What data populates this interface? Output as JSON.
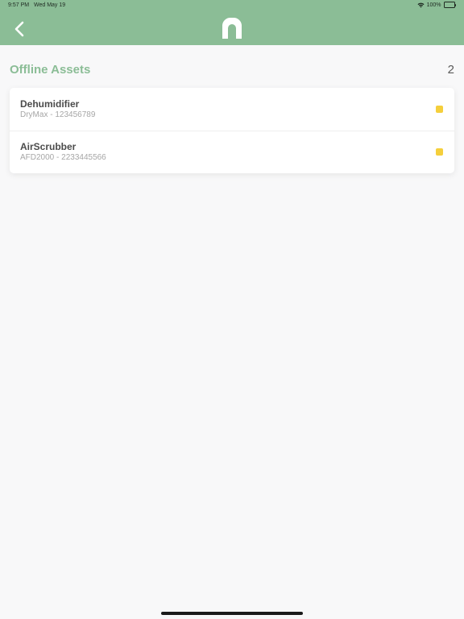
{
  "status_bar": {
    "time": "9:57 PM",
    "date": "Wed May 19",
    "battery": "100%"
  },
  "header": {
    "back_icon": "chevron-left-icon",
    "logo_icon": "arch-logo-icon",
    "color": "#8bbd96"
  },
  "section": {
    "title": "Offline Assets",
    "count": "2"
  },
  "assets": [
    {
      "name": "Dehumidifier",
      "detail": "DryMax - 123456789",
      "status_color": "#f5cf3c"
    },
    {
      "name": "AirScrubber",
      "detail": "AFD2000 - 2233445566",
      "status_color": "#f5cf3c"
    }
  ]
}
